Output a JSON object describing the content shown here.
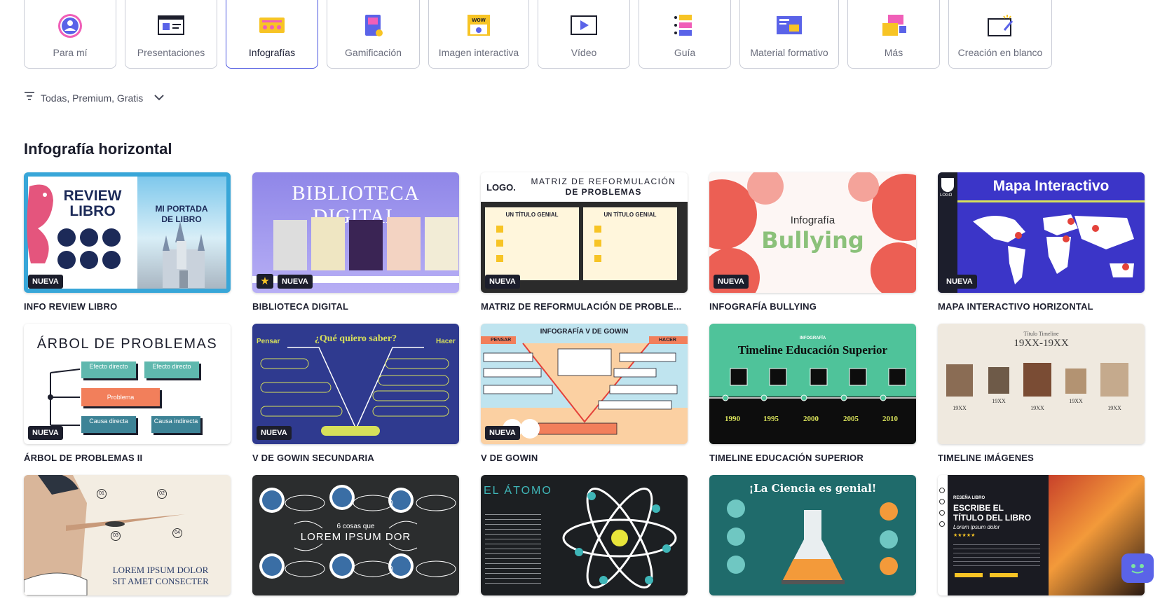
{
  "categories": [
    {
      "label": "Para mí",
      "icon": "user-avatar-icon",
      "active": false
    },
    {
      "label": "Presentaciones",
      "icon": "presentation-icon",
      "active": false
    },
    {
      "label": "Infografías",
      "icon": "infographic-icon",
      "active": true
    },
    {
      "label": "Gamificación",
      "icon": "game-console-icon",
      "active": false
    },
    {
      "label": "Imagen interactiva",
      "icon": "interactive-image-icon",
      "active": false
    },
    {
      "label": "Vídeo",
      "icon": "video-play-icon",
      "active": false
    },
    {
      "label": "Guía",
      "icon": "guide-icon",
      "active": false
    },
    {
      "label": "Material formativo",
      "icon": "training-material-icon",
      "active": false
    },
    {
      "label": "Más",
      "icon": "more-icon",
      "active": false
    },
    {
      "label": "Creación en blanco",
      "icon": "blank-creation-icon",
      "active": false
    }
  ],
  "filter": {
    "label": "Todas, Premium, Gratis",
    "icon": "filter-icon",
    "chevron": "chevron-down-icon"
  },
  "section": {
    "title": "Infografía horizontal"
  },
  "templates": [
    {
      "title": "INFO REVIEW LIBRO",
      "badge": "NUEVA",
      "thumb": {
        "t1": "REVIEW",
        "t2": "LIBRO",
        "t3": "MI PORTADA",
        "t4": "DE LIBRO"
      }
    },
    {
      "title": "BIBLIOTECA DIGITAL",
      "badge": "NUEVA",
      "premium": true,
      "thumb": {
        "t1": "BIBLIOTECA DIGITAL"
      }
    },
    {
      "title": "MATRIZ DE REFORMULACIÓN DE PROBLE...",
      "badge": "NUEVA",
      "thumb": {
        "t1": "LOGO.",
        "t2": "MATRIZ DE REFORMULACIÓN",
        "t3": "DE PROBLEMAS",
        "t4": "UN TÍTULO GENIAL",
        "t5": "UN TÍTULO GENIAL"
      }
    },
    {
      "title": "INFOGRAFÍA BULLYING",
      "badge": "NUEVA",
      "thumb": {
        "t1": "Infografía",
        "t2": "Bullying"
      }
    },
    {
      "title": "MAPA INTERACTIVO HORIZONTAL",
      "badge": "NUEVA",
      "thumb": {
        "t1": "Mapa Interactivo",
        "t2": "LOGO"
      }
    },
    {
      "title": "ÁRBOL DE PROBLEMAS II",
      "badge": "NUEVA",
      "thumb": {
        "t1": "ÁRBOL DE PROBLEMAS",
        "t2": "Efecto directo",
        "t3": "Efecto directo",
        "t4": "Problema",
        "t5": "Causa directa",
        "t6": "Causa indirecta"
      }
    },
    {
      "title": "V DE GOWIN SECUNDARIA",
      "badge": "NUEVA",
      "thumb": {
        "t1": "¿Qué quiero saber?",
        "t2": "Pensar",
        "t3": "Hacer"
      }
    },
    {
      "title": "V DE GOWIN",
      "badge": "NUEVA",
      "thumb": {
        "t1": "INFOGRAFÍA V DE GOWIN",
        "t2": "PENSAR",
        "t3": "HACER"
      }
    },
    {
      "title": "TIMELINE EDUCACIÓN SUPERIOR",
      "badge": "",
      "thumb": {
        "t1": "INFOGRAFÍA",
        "t2": "Timeline Educación Superior",
        "years": [
          "1990",
          "1995",
          "2000",
          "2005",
          "2010"
        ]
      }
    },
    {
      "title": "TIMELINE IMÁGENES",
      "badge": "",
      "thumb": {
        "t1": "Título Timeline",
        "t2": "19XX-19XX",
        "years": [
          "19XX",
          "19XX",
          "19XX",
          "19XX",
          "19XX"
        ]
      }
    },
    {
      "title": "",
      "badge": "",
      "thumb": {
        "t1": "LOREM IPSUM DOLOR",
        "t2": "SIT AMET CONSECTER",
        "nums": [
          "01",
          "02",
          "03",
          "04"
        ]
      }
    },
    {
      "title": "",
      "badge": "",
      "thumb": {
        "t1": "6 cosas que",
        "t2": "LOREM IPSUM DOR"
      }
    },
    {
      "title": "",
      "badge": "",
      "thumb": {
        "t1": "EL ÁTOMO"
      }
    },
    {
      "title": "",
      "badge": "",
      "thumb": {
        "t1": "¡La Ciencia es genial!"
      }
    },
    {
      "title": "",
      "badge": "",
      "thumb": {
        "t1": "RESEÑA LIBRO",
        "t2": "ESCRIBE EL",
        "t3": "TÍTULO DEL LIBRO",
        "t4": "Lorem ipsum dolor"
      }
    }
  ]
}
